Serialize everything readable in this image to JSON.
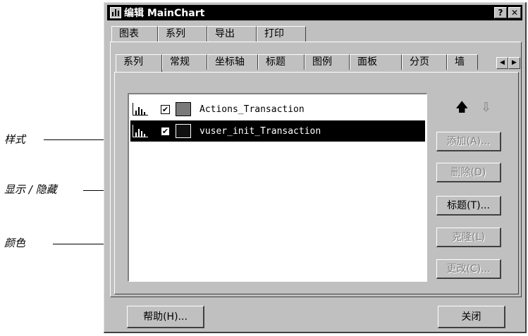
{
  "dialog": {
    "title": "编辑 MainChart",
    "help_glyph": "?",
    "close_glyph": "✕"
  },
  "main_tabs": [
    {
      "label": "图表"
    },
    {
      "label": "系列"
    },
    {
      "label": "导出"
    },
    {
      "label": "打印"
    }
  ],
  "sub_tabs": [
    {
      "label": "系列"
    },
    {
      "label": "常规"
    },
    {
      "label": "坐标轴"
    },
    {
      "label": "标题"
    },
    {
      "label": "图例"
    },
    {
      "label": "面板"
    },
    {
      "label": "分页"
    },
    {
      "label": "墙"
    }
  ],
  "series_list": [
    {
      "name": "Actions_Transaction",
      "checked": true,
      "color": "#7a7a7a",
      "selected": false
    },
    {
      "name": "vuser_init_Transaction",
      "checked": true,
      "color": "#111111",
      "selected": true
    }
  ],
  "side_buttons": {
    "add": "添加(A)...",
    "delete": "删除(D)",
    "title": "标题(T)...",
    "clone": "克隆(L)",
    "change": "更改(C)..."
  },
  "footer": {
    "help": "帮助(H)...",
    "close": "关闭"
  },
  "callouts": {
    "style": "样式",
    "show_hide": "显示 / 隐藏",
    "color": "颜色"
  },
  "glyphs": {
    "move_up": "🡅",
    "move_down": "⇩",
    "check": "✔",
    "scroll_left": "◀",
    "scroll_right": "▶"
  },
  "colors": {
    "window_bg": "#c0c0c0",
    "titlebar": "#000000",
    "selection": "#000000"
  }
}
